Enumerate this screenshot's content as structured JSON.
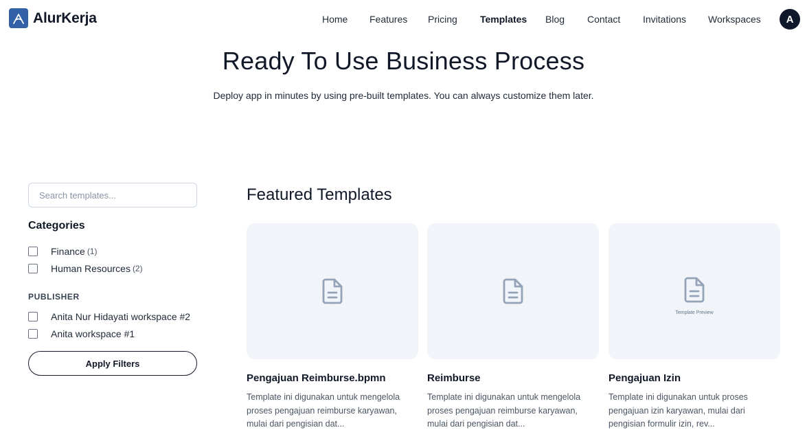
{
  "brand": {
    "name": "AlurKerja",
    "logo_color": "#3361a8"
  },
  "nav": {
    "items": [
      {
        "label": "Home"
      },
      {
        "label": "Features"
      },
      {
        "label": "Pricing"
      },
      {
        "label": "Templates",
        "active": true
      },
      {
        "label": "Blog"
      },
      {
        "label": "Contact"
      },
      {
        "label": "Invitations"
      },
      {
        "label": "Workspaces"
      }
    ],
    "avatar_initial": "A"
  },
  "hero": {
    "title": "Ready To Use Business Process",
    "subtitle": "Deploy app in minutes by using pre-built templates. You can always customize them later."
  },
  "sidebar": {
    "search_placeholder": "Search templates...",
    "categories_heading": "Categories",
    "categories": [
      {
        "label": "Finance",
        "count": "(1)",
        "checked": false
      },
      {
        "label": "Human Resources",
        "count": "(2)",
        "checked": false
      }
    ],
    "publisher_heading": "PUBLISHER",
    "publishers": [
      {
        "label": "Anita Nur Hidayati workspace #2",
        "checked": false
      },
      {
        "label": "Anita workspace #1",
        "checked": false
      }
    ],
    "apply_label": "Apply Filters"
  },
  "featured": {
    "heading": "Featured Templates",
    "cards": [
      {
        "title": "Pengajuan Reimburse.bpmn",
        "description": "Template ini digunakan untuk mengelola proses pengajuan reimburse karyawan, mulai dari pengisian dat...",
        "preview_caption": "",
        "icon": "document-icon"
      },
      {
        "title": "Reimburse",
        "description": "Template ini digunakan untuk mengelola proses pengajuan reimburse karyawan, mulai dari pengisian dat...",
        "preview_caption": "",
        "icon": "document-icon"
      },
      {
        "title": "Pengajuan Izin",
        "description": "Template ini digunakan untuk proses pengajuan izin karyawan, mulai dari pengisian formulir izin, rev...",
        "preview_caption": "Template Preview",
        "icon": "document-icon"
      }
    ]
  },
  "colors": {
    "card_background": "#f1f4f8",
    "icon": "#94a3b8",
    "avatar": "#0f172a"
  }
}
